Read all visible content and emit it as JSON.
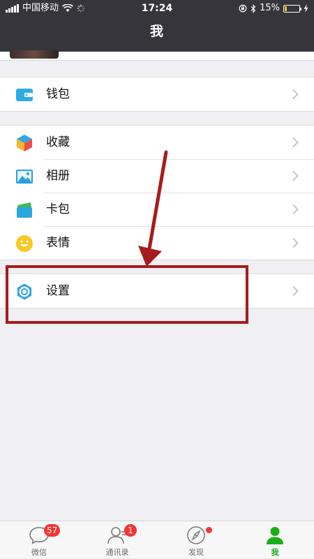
{
  "status_bar": {
    "carrier": "中国移动",
    "time": "17:24",
    "battery": "15%",
    "battery_level": 0.15
  },
  "header": {
    "title": "我"
  },
  "groups": [
    {
      "items": [
        {
          "label": "钱包",
          "icon": "wallet-icon"
        }
      ]
    },
    {
      "items": [
        {
          "label": "收藏",
          "icon": "favorites-cube-icon"
        },
        {
          "label": "相册",
          "icon": "album-image-icon"
        },
        {
          "label": "卡包",
          "icon": "cards-icon"
        },
        {
          "label": "表情",
          "icon": "smiley-face-icon"
        }
      ]
    },
    {
      "items": [
        {
          "label": "设置",
          "icon": "gear-icon"
        }
      ]
    }
  ],
  "tabbar": {
    "tabs": [
      {
        "label": "微信",
        "icon": "chat-bubble-icon",
        "badge": "57"
      },
      {
        "label": "通讯录",
        "icon": "contacts-icon",
        "badge": "1"
      },
      {
        "label": "发现",
        "icon": "compass-icon",
        "dot": true
      },
      {
        "label": "我",
        "icon": "person-icon",
        "active": true
      }
    ]
  },
  "colors": {
    "header_bg": "#36353b",
    "page_bg": "#efeff4",
    "active_tab": "#1aad19",
    "badge": "#f43530",
    "annotation": "#a61c1c"
  }
}
